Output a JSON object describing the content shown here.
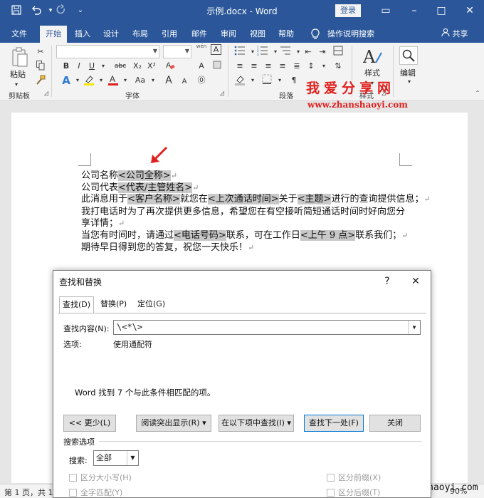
{
  "titlebar": {
    "title": "示例.docx - Word",
    "login": "登录",
    "icons": [
      "save-icon",
      "undo-icon",
      "redo-icon",
      "customize-icon"
    ],
    "controls": [
      "▭",
      "–",
      "□",
      "✕"
    ]
  },
  "tabs": [
    "文件",
    "开始",
    "插入",
    "设计",
    "布局",
    "引用",
    "邮件",
    "审阅",
    "视图",
    "帮助",
    "操作说明搜索"
  ],
  "active_tab": "开始",
  "share": "共享",
  "ribbon": {
    "paste": "粘贴",
    "clipboard": "剪贴板",
    "font": "字体",
    "paragraph": "段落",
    "styles_btn": "样式",
    "styles": "样式",
    "editing": "编辑",
    "wen": "wén",
    "font_buttons": [
      "B",
      "I",
      "U",
      "abc",
      "X₂",
      "X²",
      "A",
      "A",
      "Aa",
      "A",
      "⓪"
    ],
    "font_grow": "A",
    "font_shrink": "A"
  },
  "watermark": {
    "text": "我爱分享网",
    "url": "www.zhanshaoyi.com",
    "bottom": "zhanshaoyi.com"
  },
  "document": {
    "lines": [
      [
        {
          "t": "公司名称"
        },
        {
          "t": "<公司全称>",
          "h": true
        },
        {
          "t": "↵",
          "p": true
        }
      ],
      [
        {
          "t": "公司代表"
        },
        {
          "t": "<代表/主管姓名>",
          "h": true
        },
        {
          "t": "↵",
          "p": true
        }
      ],
      [
        {
          "t": "此消息用于"
        },
        {
          "t": "<客户名称>",
          "h": true
        },
        {
          "t": "就您在"
        },
        {
          "t": "<上次通话时间>",
          "h": true
        },
        {
          "t": "关于"
        },
        {
          "t": "<主题>",
          "h": true
        },
        {
          "t": "进行的查询提供信息；"
        },
        {
          "t": "↵",
          "p": true
        }
      ],
      [
        {
          "t": "我打电话时为了再次提供更多信息，希望您在有空接听简短通话时间时好向您分"
        }
      ],
      [
        {
          "t": "享详情；"
        },
        {
          "t": "↵",
          "p": true
        }
      ],
      [
        {
          "t": "当您有时间时，请通过"
        },
        {
          "t": "<电话号码>",
          "h": true
        },
        {
          "t": "联系，可在工作日"
        },
        {
          "t": "<上午 9 点>",
          "h": true
        },
        {
          "t": "联系我们；"
        },
        {
          "t": "↵",
          "p": true
        }
      ],
      [
        {
          "t": "期待早日得到您的答复，祝您一天快乐！"
        },
        {
          "t": "↵",
          "p": true
        }
      ]
    ]
  },
  "dialog": {
    "title": "查找和替换",
    "help": "?",
    "close": "✕",
    "tabs": [
      "查找(D)",
      "替换(P)",
      "定位(G)"
    ],
    "find_label": "查找内容(N):",
    "find_value": "\\<*\\>",
    "options_label": "选项:",
    "options_value": "使用通配符",
    "result": "Word 找到 7 个与此条件相匹配的项。",
    "buttons": {
      "less": "<< 更少(L)",
      "reading_highlight": "阅读突出显示(R) ▾",
      "find_in": "在以下项中查找(I) ▾",
      "find_next": "查找下一处(F)",
      "close": "关闭"
    },
    "search_options": "搜索选项",
    "search_label": "搜索:",
    "search_value": "全部",
    "checkboxes": [
      "区分大小写(H)",
      "全字匹配(Y)",
      "区分前缀(X)",
      "区分后缀(T)"
    ]
  },
  "status": {
    "page": "第 1 页，共 1",
    "zoom": "90%"
  }
}
